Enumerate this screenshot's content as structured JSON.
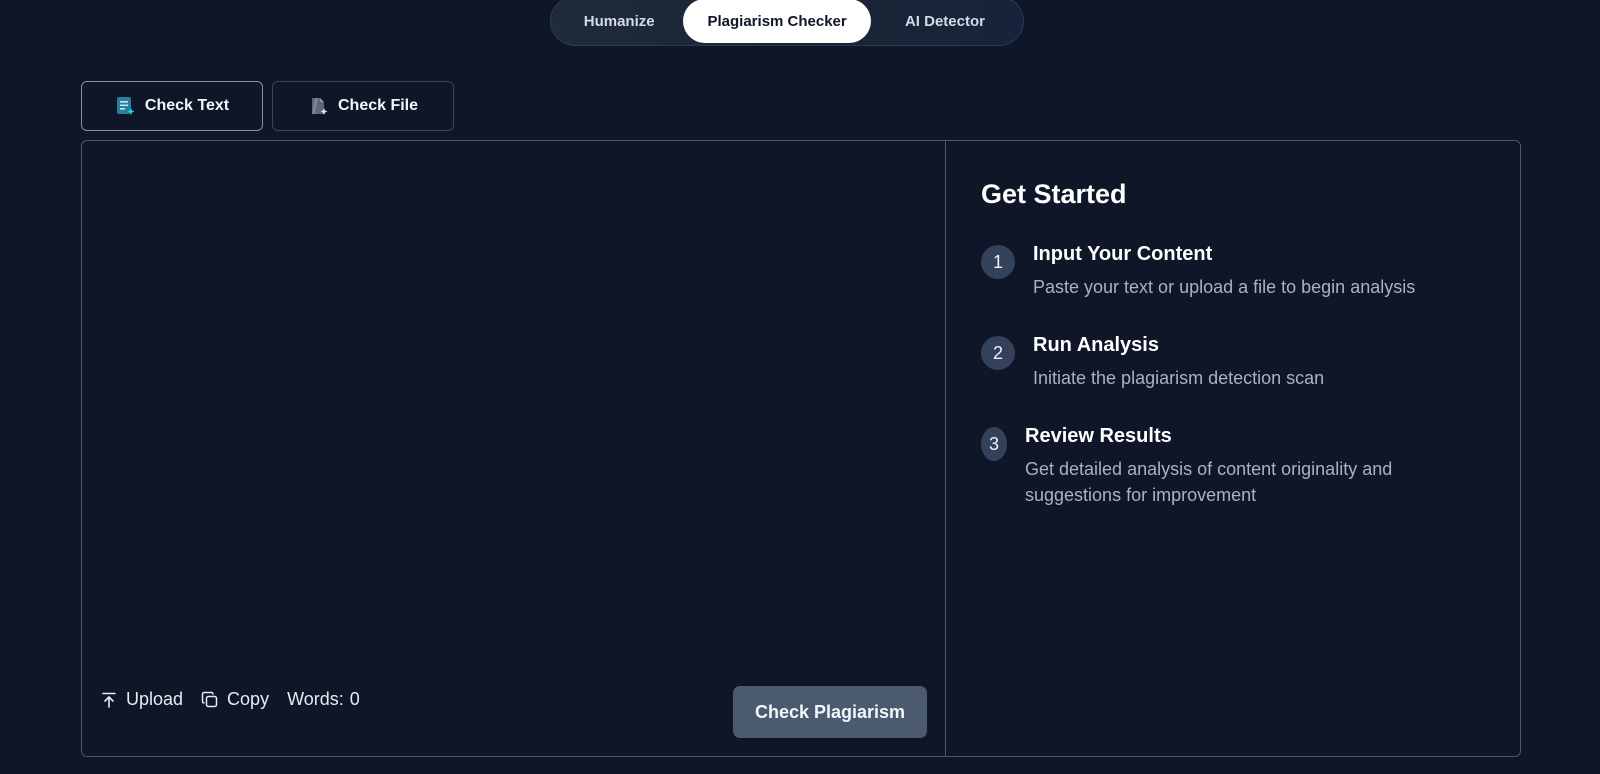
{
  "top_switch": {
    "humanize": "Humanize",
    "plagiarism_checker": "Plagiarism Checker",
    "ai_detector": "AI Detector"
  },
  "mode_tabs": {
    "check_text": "Check Text",
    "check_file": "Check File"
  },
  "editor": {
    "placeholder": "",
    "upload": "Upload",
    "copy": "Copy",
    "words_label": "Words:",
    "words_count": "0",
    "check_button": "Check Plagiarism"
  },
  "guide": {
    "title": "Get Started",
    "steps": [
      {
        "num": "1",
        "title": "Input Your Content",
        "desc": "Paste your text or upload a file to begin analysis"
      },
      {
        "num": "2",
        "title": "Run Analysis",
        "desc": "Initiate the plagiarism detection scan"
      },
      {
        "num": "3",
        "title": "Review Results",
        "desc": "Get detailed analysis of content originality and suggestions for improvement"
      }
    ]
  },
  "colors": {
    "background": "#0e1628",
    "accent_teal": "#22b8cf",
    "button_gray": "#4b5a6e"
  }
}
